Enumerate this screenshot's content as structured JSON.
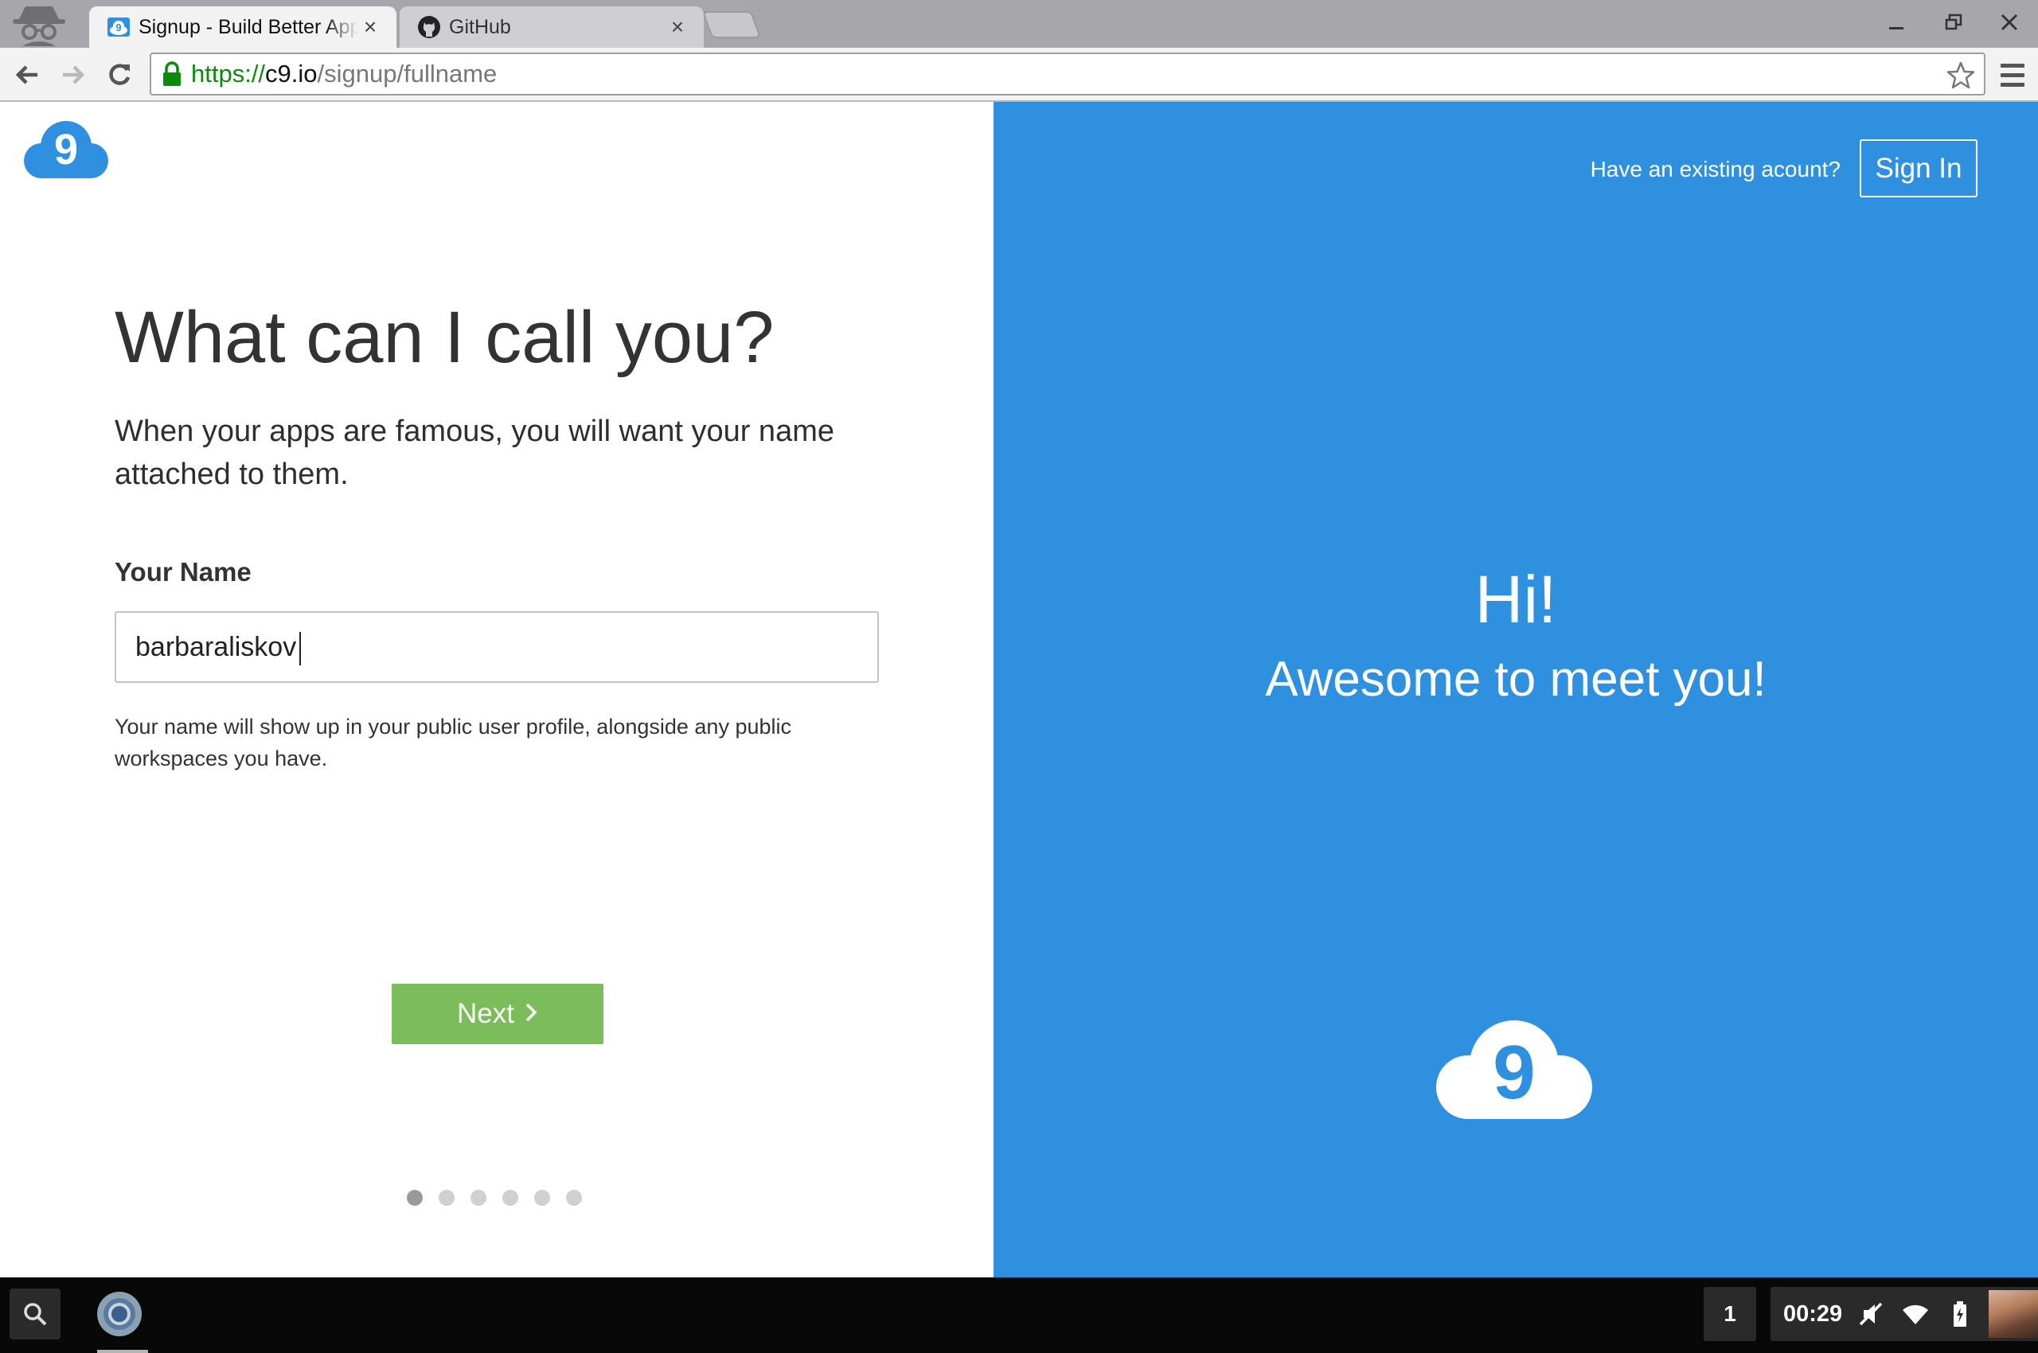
{
  "browser": {
    "tabs": [
      {
        "title": "Signup - Build Better Apps",
        "active": true,
        "favicon": "c9-cloud-icon"
      },
      {
        "title": "GitHub",
        "active": false,
        "favicon": "github-icon"
      }
    ],
    "address": {
      "scheme": "https://",
      "host": "c9.io",
      "path": "/signup/fullname"
    },
    "colors": {
      "secure": "#0b8a0b"
    }
  },
  "left": {
    "heading": "What can I call you?",
    "lead": "When your apps are famous, you will want your name attached to them.",
    "field_label": "Your Name",
    "name_value": "barbaraliskov",
    "help": "Your name will show up in your public user profile, alongside any public workspaces you have.",
    "next_label": "Next",
    "progress": {
      "current_step": 1,
      "total_steps": 6
    }
  },
  "right": {
    "existing_prompt": "Have an existing acount?",
    "signin_label": "Sign In",
    "greeting": "Hi!",
    "subgreeting": "Awesome to meet you!",
    "colors": {
      "panel": "#2e90df",
      "next_button": "#7bbd5b"
    }
  },
  "shelf": {
    "desk_number": "1",
    "clock": "00:29"
  }
}
